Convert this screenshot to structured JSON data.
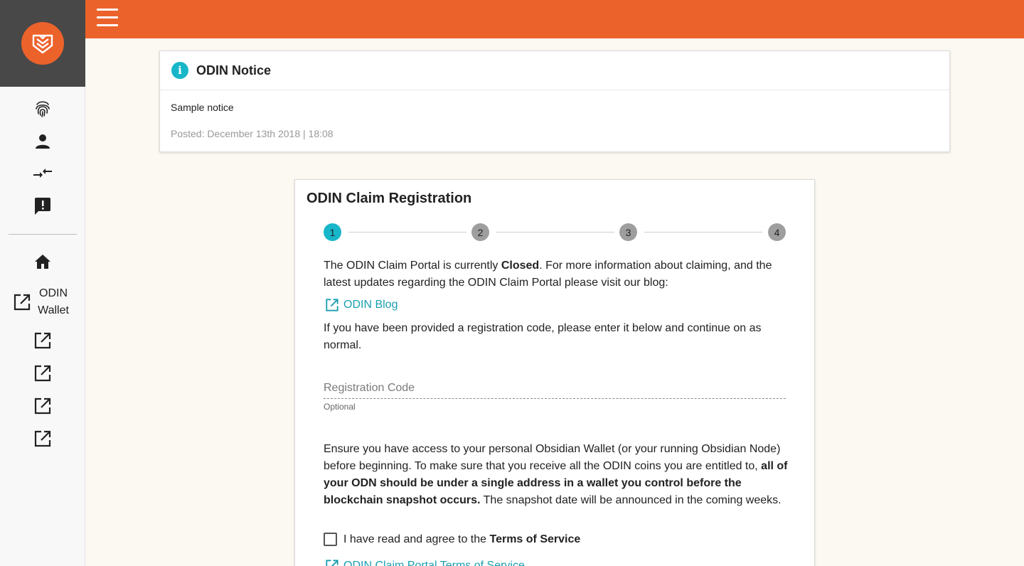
{
  "sidebar": {
    "wallet_label": "ODIN Wallet"
  },
  "notice": {
    "title": "ODIN Notice",
    "body": "Sample notice",
    "posted": "Posted: December 13th 2018 | 18:08"
  },
  "claim": {
    "title": "ODIN Claim Registration",
    "steps": [
      "1",
      "2",
      "3",
      "4"
    ],
    "status_intro": "The ODIN Claim Portal is currently ",
    "status_word": "Closed",
    "status_rest": ". For more information about claiming, and the latest updates regarding the ODIN Claim Portal please visit our blog:",
    "blog_link": "ODIN Blog",
    "code_text": "If you have been provided a registration code, please enter it below and continue on as normal.",
    "reg_placeholder": "Registration Code",
    "reg_value": "",
    "reg_hint": "Optional",
    "ensure_start": "Ensure you have access to your personal Obsidian Wallet (or your running Obsidian Node) before beginning. To make sure that you receive all the ODIN coins you are entitled to, ",
    "ensure_bold": "all of your ODN should be under a single address in a wallet you control before the blockchain snapshot occurs.",
    "ensure_end": " The snapshot date will be announced in the coming weeks.",
    "tos_prefix": "I have read and agree to the ",
    "tos_bold": "Terms of Service",
    "tos_link": "ODIN Claim Portal Terms of Service"
  },
  "colors": {
    "brand_orange": "#ec622b",
    "accent_teal": "#17b6c8",
    "link_teal": "#1a9fb0",
    "sidebar_dark": "#484848"
  }
}
